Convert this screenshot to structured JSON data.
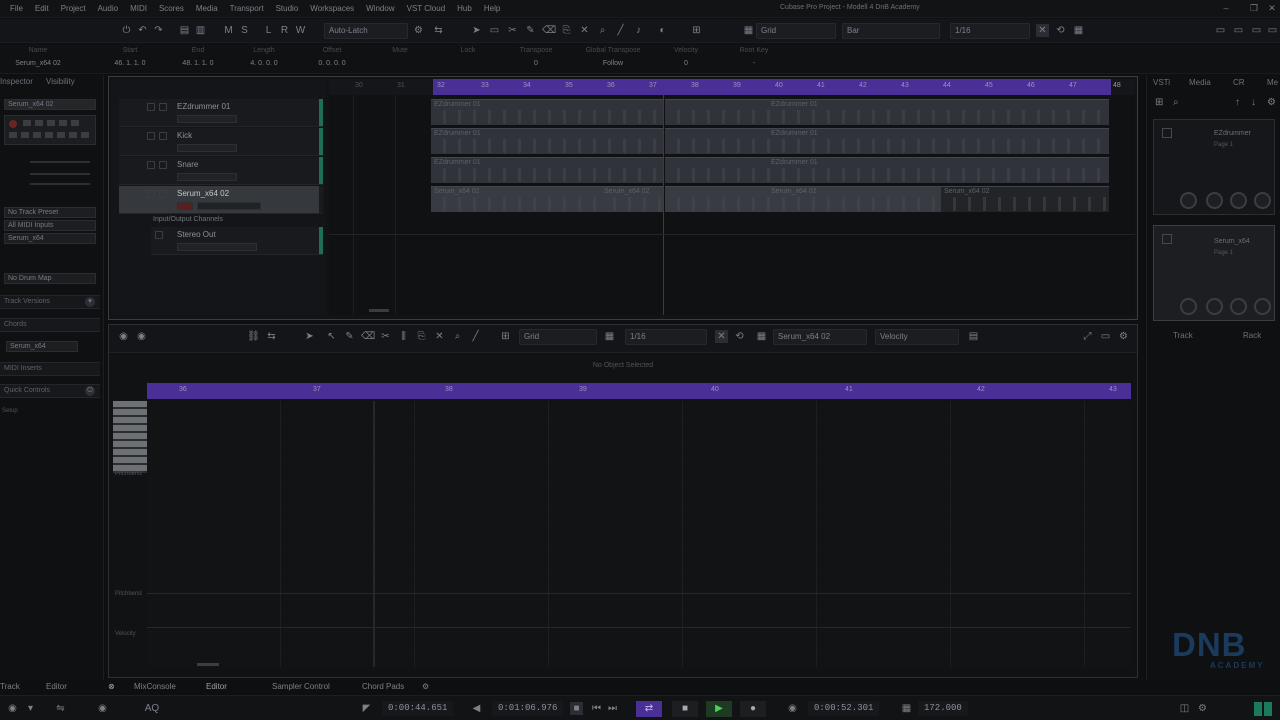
{
  "menubar": {
    "items": [
      "File",
      "Edit",
      "Project",
      "Audio",
      "MIDI",
      "Scores",
      "Media",
      "Transport",
      "Studio",
      "Workspaces",
      "Window",
      "VST Cloud",
      "Hub",
      "Help"
    ],
    "window_title": "Cubase Pro Project - Modell 4 DnB Academy"
  },
  "toolbar": {
    "auto_latch": "Auto-Latch",
    "grid": "Grid",
    "bar": "Bar",
    "quantize": "1/16"
  },
  "infoline": {
    "columns": [
      {
        "label": "Name",
        "value": "Serum_x64 02"
      },
      {
        "label": "Start",
        "value": "46. 1. 1. 0"
      },
      {
        "label": "End",
        "value": "48. 1. 1. 0"
      },
      {
        "label": "Length",
        "value": "4. 0. 0. 0"
      },
      {
        "label": "Offset",
        "value": "0. 0. 0. 0"
      },
      {
        "label": "Mute",
        "value": ""
      },
      {
        "label": "Lock",
        "value": ""
      },
      {
        "label": "Transpose",
        "value": "0"
      },
      {
        "label": "Global Transpose",
        "value": "Follow"
      },
      {
        "label": "Velocity",
        "value": "0"
      },
      {
        "label": "Root Key",
        "value": "-"
      }
    ]
  },
  "inspector": {
    "tabs": [
      "Inspector",
      "Visibility"
    ],
    "track_name": "Serum_x64 02",
    "no_track_preset": "No Track Preset",
    "all_midi_inputs": "All MIDI Inputs",
    "output": "Serum_x64",
    "no_drum_map": "No Drum Map",
    "sections": [
      "Track Versions",
      "Chords",
      "MIDI Inserts",
      "Quick Controls"
    ],
    "chord_field": "Serum_x64",
    "setup": "Setup"
  },
  "tracks": [
    {
      "name": "EZdrummer 01"
    },
    {
      "name": "Kick"
    },
    {
      "name": "Snare"
    },
    {
      "name": "Serum_x64 02"
    },
    {
      "name": "Input/Output Channels"
    },
    {
      "name": "Stereo Out"
    }
  ],
  "arrange": {
    "ruler_ticks": [
      "30",
      "31",
      "32",
      "33",
      "34",
      "35",
      "36",
      "37",
      "38",
      "39",
      "40",
      "41",
      "42",
      "43",
      "44",
      "45",
      "46",
      "47",
      "48"
    ],
    "clips": {
      "ez_a": "EZdrummer 01",
      "ez_b": "EZdrummer 01",
      "kick_a": "EZdrummer 01",
      "kick_b": "EZdrummer 01",
      "snare_a": "EZdrummer 01",
      "snare_b": "EZdrummer 01",
      "serum_a": "Serum_x64 02",
      "serum_b": "Serum_x64 02",
      "serum_c": "Serum_x64 02",
      "serum_d": "Serum_x64 02"
    }
  },
  "rightzone": {
    "tabs": [
      "VSTi",
      "Media",
      "CR",
      "Me"
    ],
    "slot1_name": "EZdrummer",
    "slot1_page": "Page 1",
    "slot2_name": "Serum_x64",
    "slot2_page": "Page 1",
    "bottom_tabs": [
      "Track",
      "Rack"
    ]
  },
  "editor": {
    "grid": "Grid",
    "quantize": "1/16",
    "track": "Serum_x64 02",
    "velocity": "Velocity",
    "status": "No Object Selected",
    "ruler_ticks": [
      "36",
      "37",
      "38",
      "39",
      "40",
      "41",
      "42",
      "43"
    ],
    "lane_labels": [
      "Pitchbend",
      "Pitchbend",
      "Velocity"
    ]
  },
  "lowerzone": {
    "tabs": [
      "Track",
      "Editor",
      "MixConsole",
      "Editor",
      "Sampler Control",
      "Chord Pads"
    ]
  },
  "transport": {
    "time_left": "0:00:44.651",
    "time_right": "0:01:06.976",
    "time_main": "0:00:52.301",
    "tempo": "172.000",
    "aq": "AQ"
  },
  "brand": {
    "logo": "DNB",
    "sub": "ACADEMY",
    "color": "#1a3a5e"
  },
  "colors": {
    "loop": "#4a3096",
    "track_active": "#1f6f52",
    "play": "#2a8a30"
  }
}
